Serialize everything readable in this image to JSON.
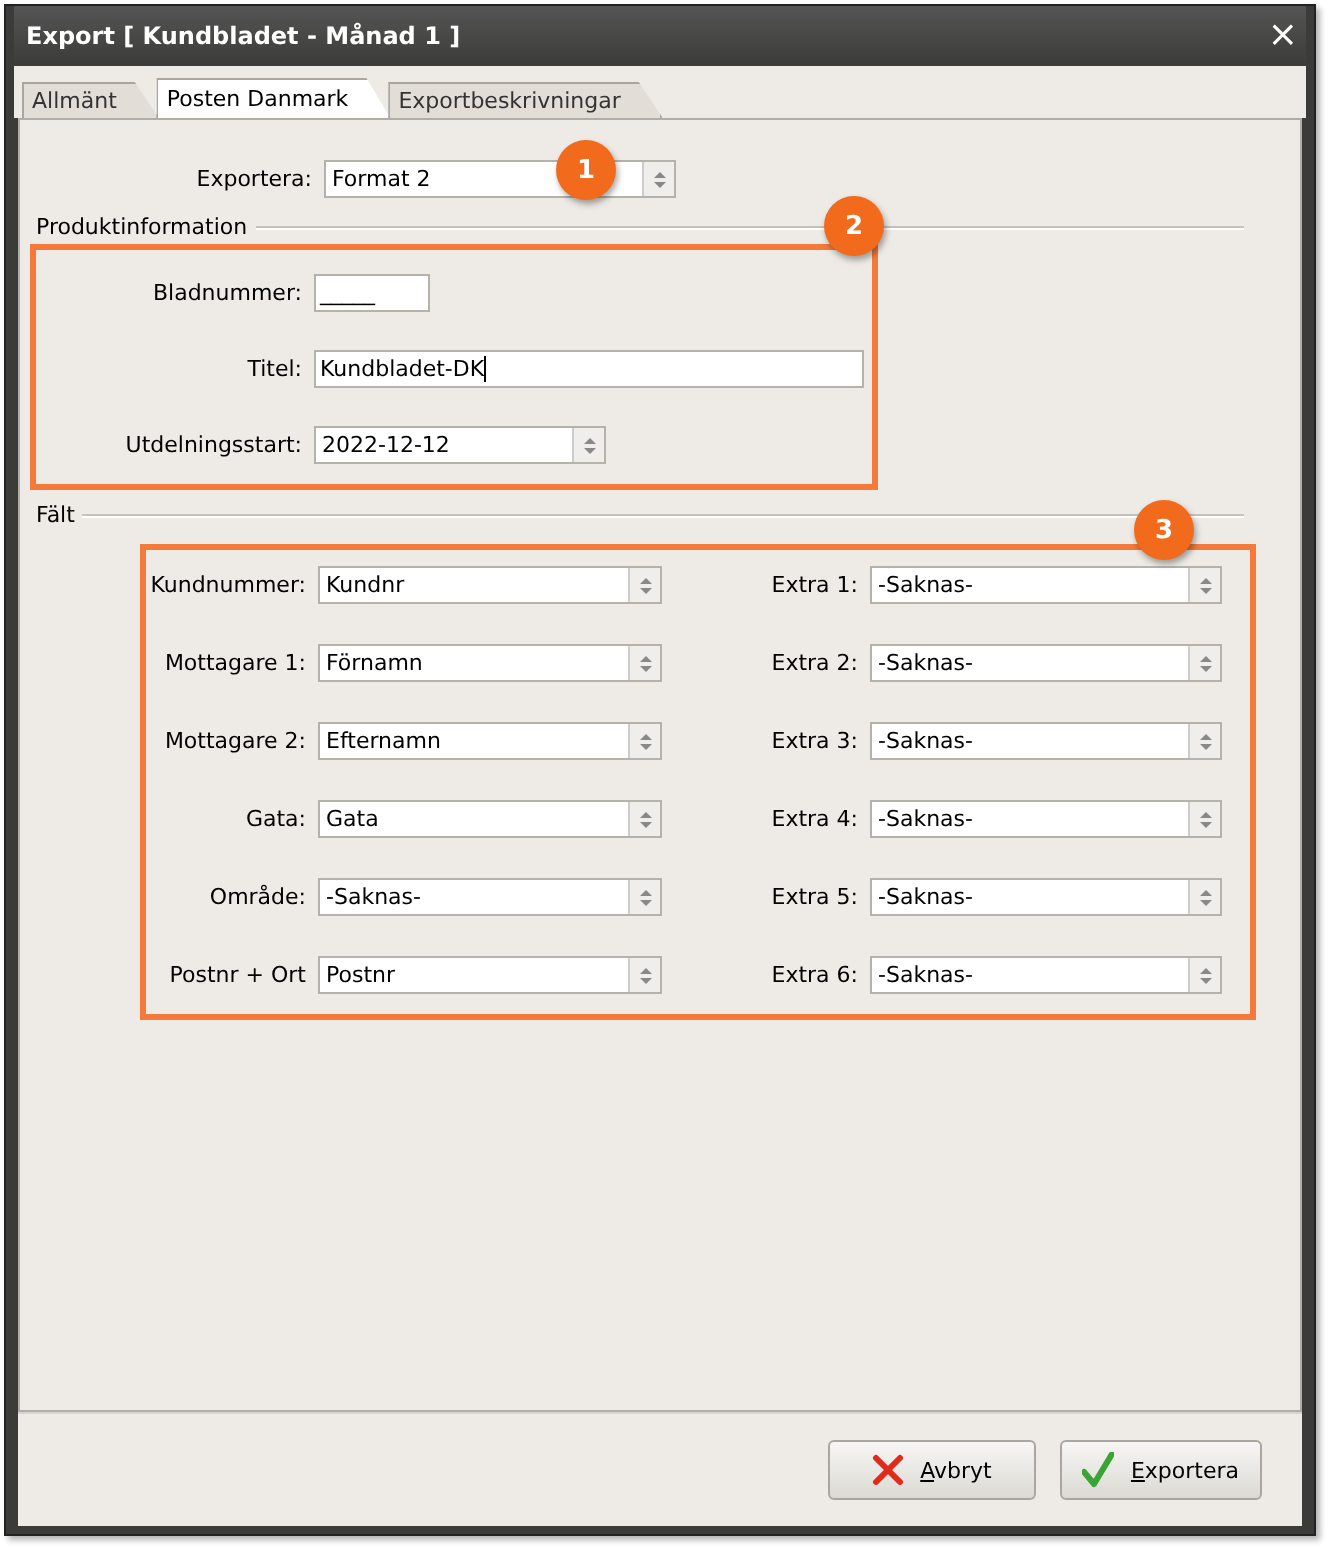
{
  "window": {
    "title": "Export [ Kundbladet - Månad 1 ]",
    "close": "×"
  },
  "tabs": [
    {
      "label": "Allmänt",
      "selected": false
    },
    {
      "label": "Posten Danmark",
      "selected": true
    },
    {
      "label": "Exportbeskrivningar",
      "selected": false
    }
  ],
  "export_format": {
    "label": "Exportera:",
    "value": "Format 2"
  },
  "product_info": {
    "legend": "Produktinformation",
    "issue_number": {
      "label": "Bladnummer:",
      "value": "_____"
    },
    "title": {
      "label": "Titel:",
      "value": "Kundbladet-DK"
    },
    "distribution_start": {
      "label": "Utdelningsstart:",
      "value": "2022-12-12"
    }
  },
  "fields": {
    "legend": "Fält",
    "left": [
      {
        "label": "Kundnummer:",
        "value": "Kundnr"
      },
      {
        "label": "Mottagare 1:",
        "value": "Förnamn"
      },
      {
        "label": "Mottagare 2:",
        "value": "Efternamn"
      },
      {
        "label": "Gata:",
        "value": "Gata"
      },
      {
        "label": "Område:",
        "value": "-Saknas-"
      },
      {
        "label": "Postnr + Ort",
        "value": "Postnr"
      }
    ],
    "right": [
      {
        "label": "Extra 1:",
        "value": "-Saknas-"
      },
      {
        "label": "Extra 2:",
        "value": "-Saknas-"
      },
      {
        "label": "Extra 3:",
        "value": "-Saknas-"
      },
      {
        "label": "Extra 4:",
        "value": "-Saknas-"
      },
      {
        "label": "Extra 5:",
        "value": "-Saknas-"
      },
      {
        "label": "Extra 6:",
        "value": "-Saknas-"
      }
    ]
  },
  "callouts": [
    "1",
    "2",
    "3"
  ],
  "buttons": [
    {
      "kind": "cancel",
      "label": "Avbryt",
      "mnemonic": true
    },
    {
      "kind": "confirm",
      "label": "Exportera",
      "mnemonic": true
    }
  ]
}
